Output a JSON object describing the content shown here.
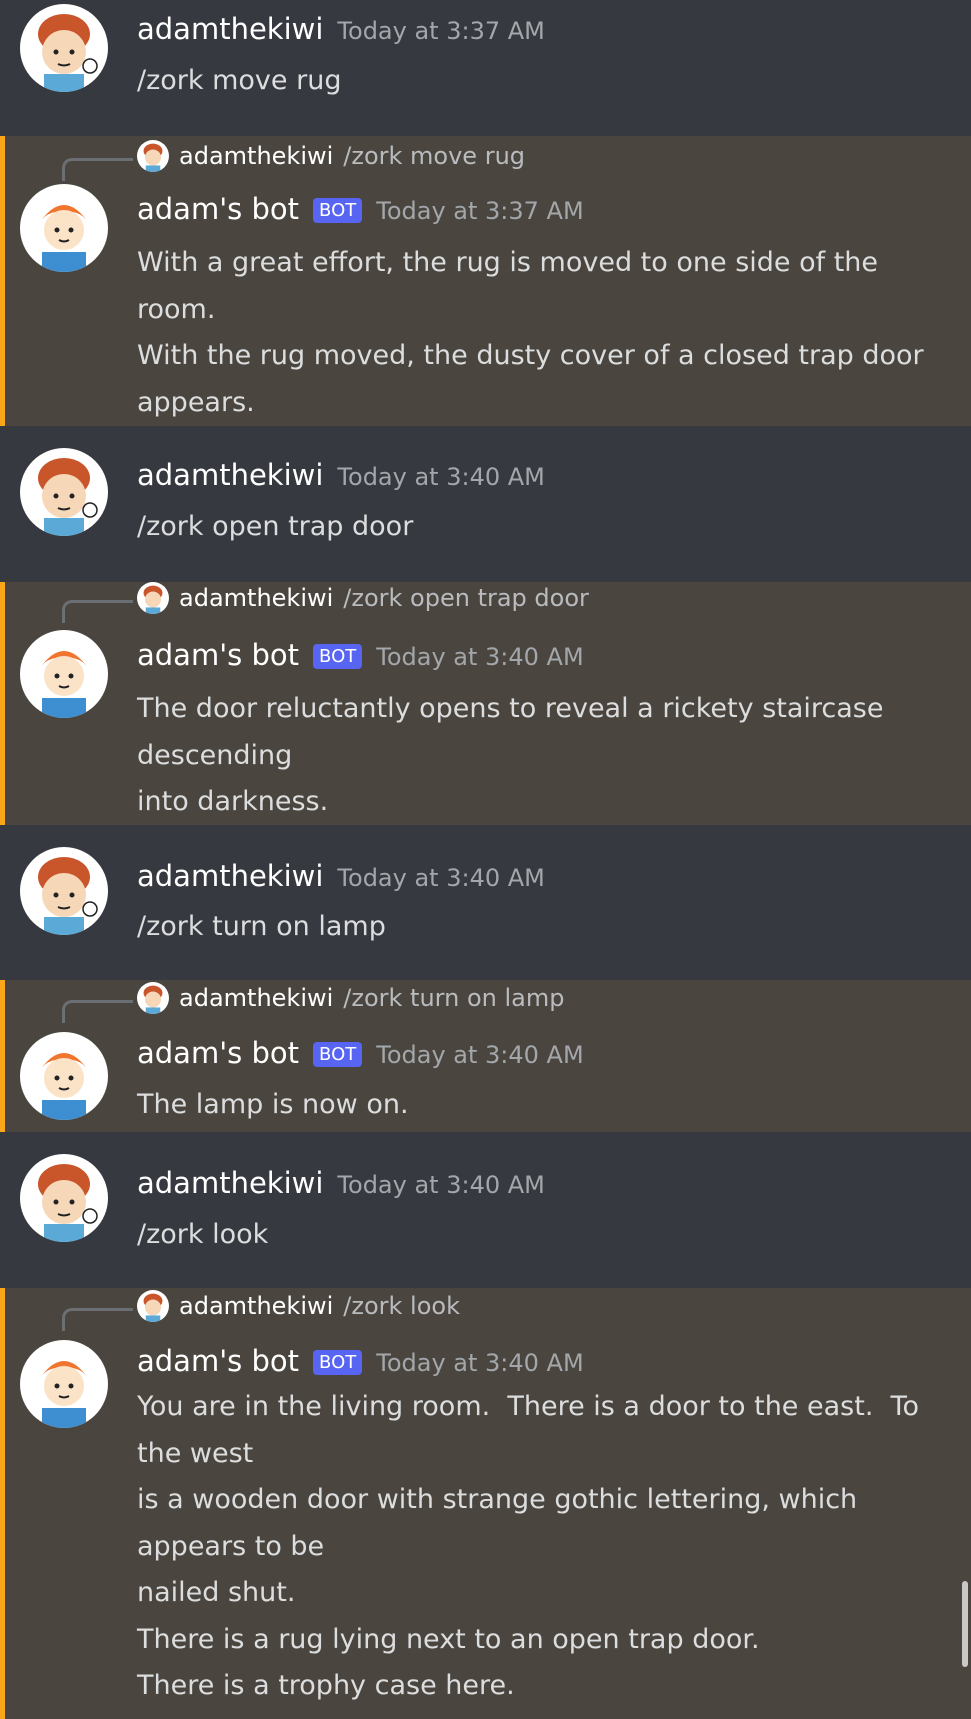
{
  "messages": [
    {
      "type": "user",
      "username": "adamthekiwi",
      "time": "Today at 3:37 AM",
      "lines": [
        "/zork move rug"
      ]
    },
    {
      "type": "bot",
      "username": "adam's bot",
      "badge": "BOT",
      "time": "Today at 3:37 AM",
      "reply": {
        "username": "adamthekiwi",
        "text": "/zork move rug"
      },
      "lines": [
        "With a great effort, the rug is moved to one side of the",
        "room.",
        "With the rug moved, the dusty cover of a closed trap door",
        "appears."
      ]
    },
    {
      "type": "user",
      "username": "adamthekiwi",
      "time": "Today at 3:40 AM",
      "lines": [
        "/zork open trap door"
      ]
    },
    {
      "type": "bot",
      "username": "adam's bot",
      "badge": "BOT",
      "time": "Today at 3:40 AM",
      "reply": {
        "username": "adamthekiwi",
        "text": "/zork open trap door"
      },
      "lines": [
        "The door reluctantly opens to reveal a rickety staircase",
        "descending",
        "into darkness."
      ]
    },
    {
      "type": "user",
      "username": "adamthekiwi",
      "time": "Today at 3:40 AM",
      "lines": [
        "/zork turn on lamp"
      ]
    },
    {
      "type": "bot",
      "username": "adam's bot",
      "badge": "BOT",
      "time": "Today at 3:40 AM",
      "reply": {
        "username": "adamthekiwi",
        "text": "/zork turn on lamp"
      },
      "lines": [
        "The lamp is now on."
      ]
    },
    {
      "type": "user",
      "username": "adamthekiwi",
      "time": "Today at 3:40 AM",
      "lines": [
        "/zork look"
      ]
    },
    {
      "type": "bot",
      "username": "adam's bot",
      "badge": "BOT",
      "time": "Today at 3:40 AM",
      "reply": {
        "username": "adamthekiwi",
        "text": "/zork look"
      },
      "lines": [
        "You are in the living room.  There is a door to the east.  To",
        "the west",
        "is a wooden door with strange gothic lettering, which",
        "appears to be",
        "nailed shut.",
        "There is a rug lying next to an open trap door.",
        "There is a trophy case here."
      ]
    }
  ],
  "colors": {
    "user_bg": "#36393f",
    "bot_bg": "#4a463f",
    "accent_bar": "#faa81a",
    "bot_badge": "#5865f2"
  },
  "icons": {
    "user_avatar": "cartoon-kiwi-avatar-icon",
    "bot_avatar": "cartoon-redhead-avatar-icon"
  }
}
